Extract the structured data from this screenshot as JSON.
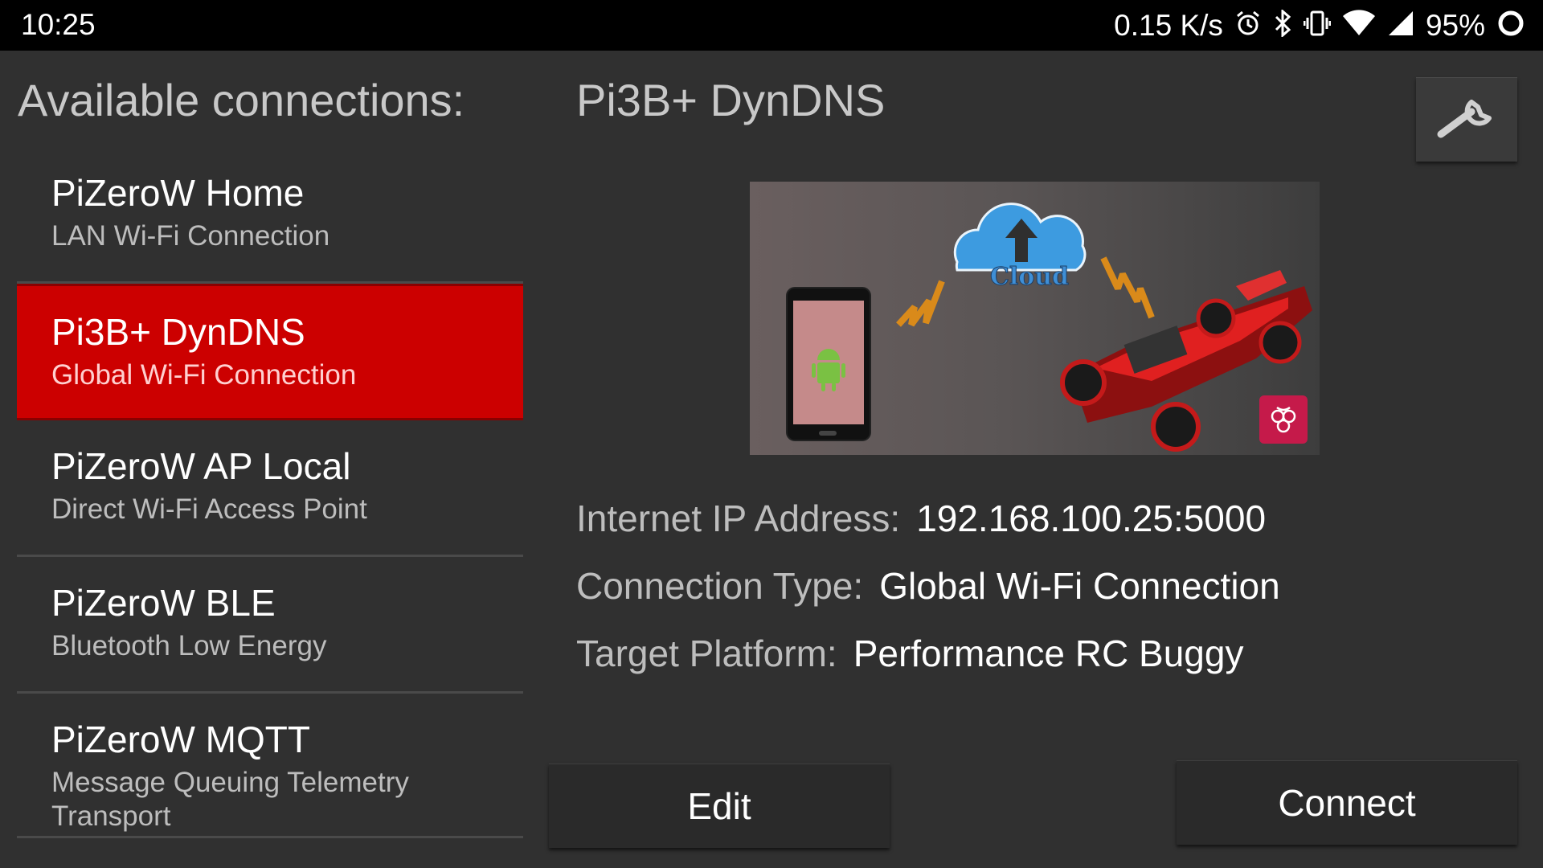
{
  "status_bar": {
    "time": "10:25",
    "net_speed": "0.15 K/s",
    "battery": "95%",
    "icons": [
      "alarm-icon",
      "bluetooth-icon",
      "vibrate-icon",
      "wifi-icon",
      "signal-icon",
      "battery-icon"
    ]
  },
  "left_panel": {
    "title": "Available connections:",
    "items": [
      {
        "name": "PiZeroW Home",
        "subtitle": "LAN Wi-Fi Connection"
      },
      {
        "name": "Pi3B+ DynDNS",
        "subtitle": "Global Wi-Fi Connection",
        "selected": true
      },
      {
        "name": "PiZeroW AP Local",
        "subtitle": "Direct Wi-Fi Access Point"
      },
      {
        "name": "PiZeroW BLE",
        "subtitle": "Bluetooth Low Energy"
      },
      {
        "name": "PiZeroW MQTT",
        "subtitle": "Message Queuing Telemetry Transport"
      }
    ]
  },
  "detail": {
    "title": "Pi3B+ DynDNS",
    "settings_icon": "wrench-icon",
    "hero_cloud_text": "Cloud",
    "fields": {
      "ip_label": "Internet IP Address:",
      "ip_value": "192.168.100.25:5000",
      "type_label": "Connection Type:",
      "type_value": "Global Wi-Fi Connection",
      "platform_label": "Target Platform:",
      "platform_value": "Performance RC Buggy"
    },
    "edit_label": "Edit",
    "connect_label": "Connect"
  },
  "colors": {
    "background": "#303030",
    "selected": "#cc0000",
    "status_bar": "#000000",
    "button": "#2a2a2a"
  }
}
